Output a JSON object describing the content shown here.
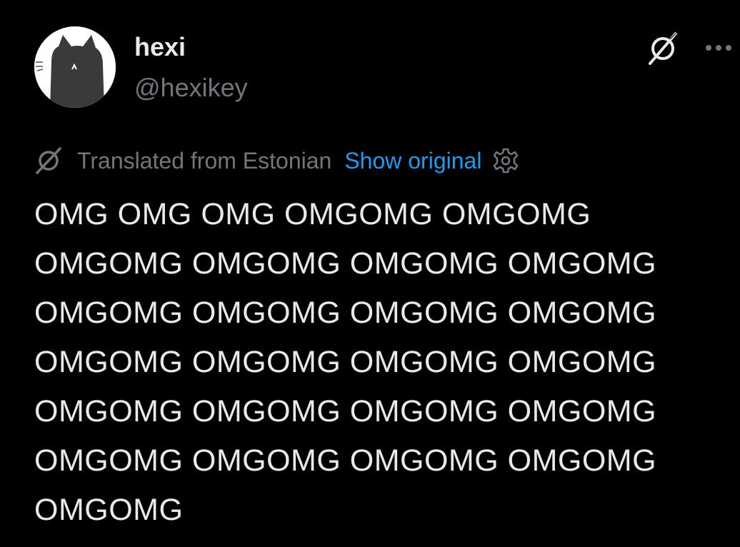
{
  "author": {
    "display_name": "hexi",
    "handle": "@hexikey",
    "avatar_icon": "black-cat-avatar"
  },
  "header_actions": {
    "grok_icon": "grok-icon",
    "more_icon": "more-options-icon"
  },
  "translation": {
    "icon": "translate-icon",
    "label": "Translated from Estonian",
    "show_original": "Show original",
    "settings_icon": "gear-icon"
  },
  "tweet": {
    "lines": [
      "OMG OMG OMG OMGOMG OMGOMG",
      "OMGOMG OMGOMG OMGOMG OMGOMG",
      "OMGOMG OMGOMG OMGOMG OMGOMG",
      "OMGOMG OMGOMG OMGOMG OMGOMG",
      "OMGOMG OMGOMG OMGOMG OMGOMG",
      "OMGOMG OMGOMG OMGOMG OMGOMG",
      "OMGOMG"
    ]
  },
  "colors": {
    "background": "#000000",
    "primary_text": "#e7e9ea",
    "secondary_text": "#71767b",
    "link": "#1d9bf0"
  }
}
